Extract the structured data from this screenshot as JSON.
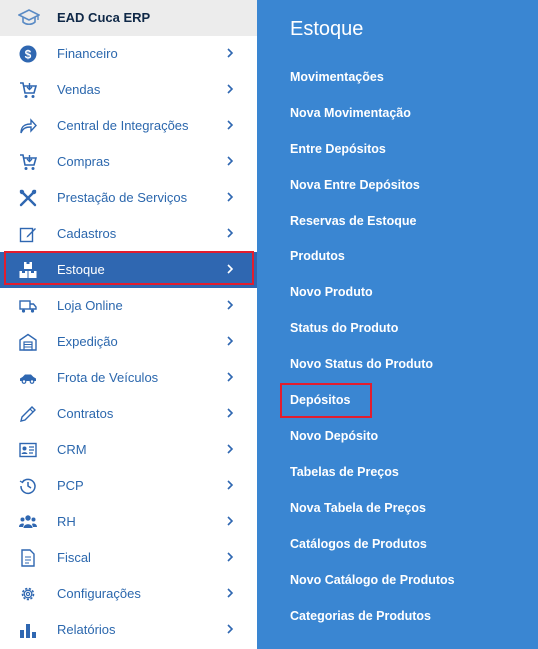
{
  "brand": {
    "label": "EAD Cuca ERP",
    "icon": "graduation-cap-icon"
  },
  "menu": [
    {
      "label": "Financeiro",
      "icon": "dollar-icon"
    },
    {
      "label": "Vendas",
      "icon": "cart-icon"
    },
    {
      "label": "Central de Integrações",
      "icon": "share-icon"
    },
    {
      "label": "Compras",
      "icon": "cart-icon"
    },
    {
      "label": "Prestação de Serviços",
      "icon": "tools-icon"
    },
    {
      "label": "Cadastros",
      "icon": "edit-icon"
    },
    {
      "label": "Estoque",
      "icon": "boxes-icon",
      "active": true
    },
    {
      "label": "Loja Online",
      "icon": "truck-icon"
    },
    {
      "label": "Expedição",
      "icon": "warehouse-icon"
    },
    {
      "label": "Frota de Veículos",
      "icon": "car-icon"
    },
    {
      "label": "Contratos",
      "icon": "pencil-icon"
    },
    {
      "label": "CRM",
      "icon": "id-card-icon"
    },
    {
      "label": "PCP",
      "icon": "clock-icon"
    },
    {
      "label": "RH",
      "icon": "people-icon"
    },
    {
      "label": "Fiscal",
      "icon": "document-icon"
    },
    {
      "label": "Configurações",
      "icon": "gear-icon"
    },
    {
      "label": "Relatórios",
      "icon": "bar-chart-icon"
    }
  ],
  "panel": {
    "title": "Estoque",
    "items": [
      "Movimentações",
      "Nova Movimentação",
      "Entre Depósitos",
      "Nova Entre Depósitos",
      "Reservas de Estoque",
      "Produtos",
      "Novo Produto",
      "Status do Produto",
      "Novo Status do Produto",
      "Depósitos",
      "Novo Depósito",
      "Tabelas de Preços",
      "Nova Tabela de Preços",
      "Catálogos de Produtos",
      "Novo Catálogo de Produtos",
      "Categorias de Produtos"
    ]
  },
  "colors": {
    "accent": "#2f67b1",
    "panel": "#3a86d2",
    "highlight": "#e11d2e",
    "text": "#2b67ad"
  }
}
